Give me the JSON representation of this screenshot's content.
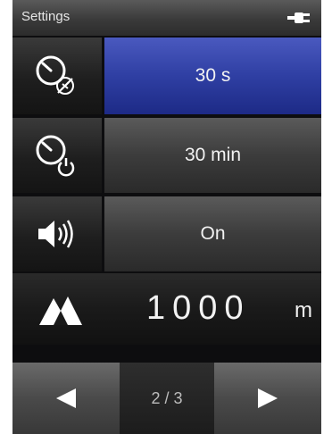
{
  "header": {
    "title": "Settings",
    "power_icon": "plug-icon"
  },
  "settings": [
    {
      "icon": "backlight-timer-icon",
      "value": "30 s",
      "selected": true
    },
    {
      "icon": "auto-off-timer-icon",
      "value": "30 min",
      "selected": false
    },
    {
      "icon": "speaker-icon",
      "value": "On",
      "selected": false
    }
  ],
  "altitude": {
    "icon": "mountain-icon",
    "value": "1000",
    "unit": "m"
  },
  "pagination": {
    "prev_icon": "left-arrow-icon",
    "page_indicator": "2 / 3",
    "next_icon": "right-arrow-icon"
  },
  "colors": {
    "selected_button": "#2f3fa3",
    "button": "#3c3c3c",
    "background": "#0d0d0f",
    "text": "#f2f2f2"
  }
}
